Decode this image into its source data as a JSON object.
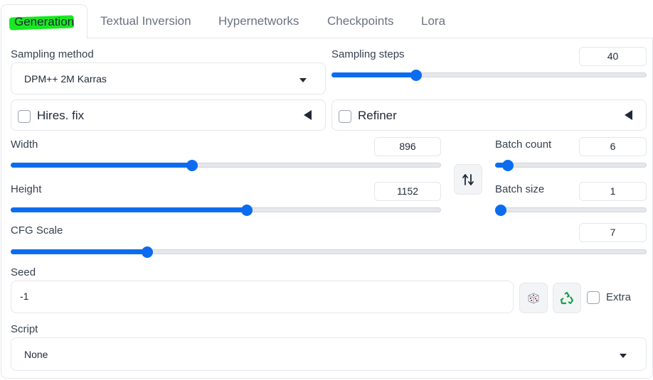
{
  "tabs": [
    {
      "label": "Generation",
      "active": true
    },
    {
      "label": "Textual Inversion"
    },
    {
      "label": "Hypernetworks"
    },
    {
      "label": "Checkpoints"
    },
    {
      "label": "Lora"
    }
  ],
  "sampling_method": {
    "label": "Sampling method",
    "value": "DPM++ 2M Karras"
  },
  "sampling_steps": {
    "label": "Sampling steps",
    "value": "40",
    "level_fraction": 0.26
  },
  "hires_fix": {
    "label": "Hires. fix",
    "checked": false
  },
  "refiner": {
    "label": "Refiner",
    "checked": false
  },
  "width": {
    "label": "Width",
    "value": "896",
    "level_fraction": 0.42
  },
  "height": {
    "label": "Height",
    "value": "1152",
    "level_fraction": 0.55
  },
  "batch_count": {
    "label": "Batch count",
    "value": "6",
    "level_fraction": 0.05
  },
  "batch_size": {
    "label": "Batch size",
    "value": "1",
    "level_fraction": 0.0
  },
  "cfg_scale": {
    "label": "CFG Scale",
    "value": "7",
    "level_fraction": 0.21
  },
  "seed": {
    "label": "Seed",
    "value": "-1",
    "extra_label": "Extra",
    "extra_checked": false
  },
  "script": {
    "label": "Script",
    "value": "None"
  },
  "icons": {
    "swap": "swap-dimensions-icon",
    "dice": "dice-icon",
    "recycle": "recycle-icon"
  },
  "colors": {
    "accent": "#0b6cf0",
    "highlight": "#00e60a"
  }
}
